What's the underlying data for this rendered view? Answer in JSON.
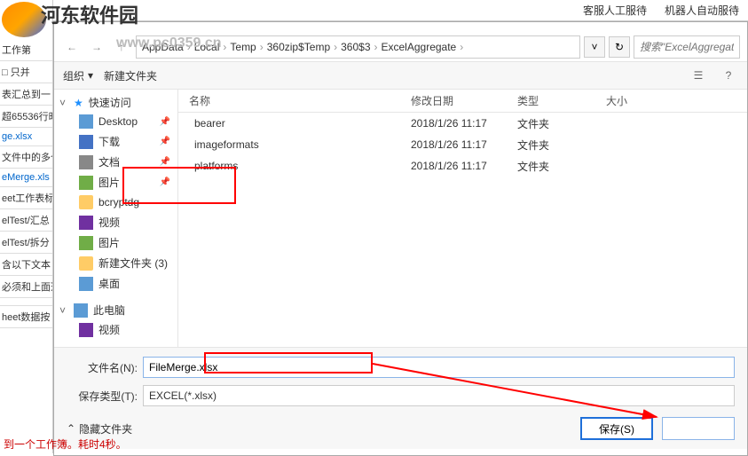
{
  "header_strip": {
    "item1": "客服人工服待",
    "item2": "机器人自动服待"
  },
  "site_title": "河东软件园",
  "watermark": "www.pc0359.cn",
  "left_panel": {
    "items": [
      {
        "text": "工作第",
        "cls": ""
      },
      {
        "text": "□ 只并",
        "cls": ""
      },
      {
        "text": "表汇总到一",
        "cls": ""
      },
      {
        "text": "超65536行时",
        "cls": ""
      },
      {
        "text": "ge.xlsx",
        "cls": "blue"
      },
      {
        "text": "文件中的多个",
        "cls": ""
      },
      {
        "text": "eMerge.xls",
        "cls": "blue"
      },
      {
        "text": "eet工作表标",
        "cls": ""
      },
      {
        "text": "elTest/汇总",
        "cls": ""
      },
      {
        "text": "elTest/拆分",
        "cls": ""
      },
      {
        "text": "含以下文本",
        "cls": ""
      },
      {
        "text": "必须和上面选",
        "cls": ""
      },
      {
        "text": "",
        "cls": ""
      },
      {
        "text": "heet数据按",
        "cls": ""
      }
    ]
  },
  "dialog": {
    "breadcrumb": [
      "AppData",
      "Local",
      "Temp",
      "360zip$Temp",
      "360$3",
      "ExcelAggregate"
    ],
    "search_placeholder": "搜索\"ExcelAggregat",
    "toolbar": {
      "organize": "组织",
      "newfolder": "新建文件夹"
    },
    "sidebar": {
      "quick": "快速访问",
      "items": [
        {
          "label": "Desktop",
          "icon": "ico-desktop",
          "pin": true
        },
        {
          "label": "下载",
          "icon": "ico-dl",
          "pin": true
        },
        {
          "label": "文档",
          "icon": "ico-doc",
          "pin": true
        },
        {
          "label": "图片",
          "icon": "ico-pic",
          "pin": true
        },
        {
          "label": "bcryptdg",
          "icon": "ico-folder",
          "pin": false
        },
        {
          "label": "视频",
          "icon": "ico-vid",
          "pin": false
        },
        {
          "label": "图片",
          "icon": "ico-pic",
          "pin": false
        },
        {
          "label": "新建文件夹 (3)",
          "icon": "ico-folder",
          "pin": false
        },
        {
          "label": "桌面",
          "icon": "ico-desktop",
          "pin": false
        }
      ],
      "thispc": "此电脑",
      "thispc_items": [
        {
          "label": "视频",
          "icon": "ico-vid"
        }
      ]
    },
    "columns": {
      "name": "名称",
      "date": "修改日期",
      "type": "类型",
      "size": "大小"
    },
    "files": [
      {
        "name": "bearer",
        "date": "2018/1/26 11:17",
        "type": "文件夹"
      },
      {
        "name": "imageformats",
        "date": "2018/1/26 11:17",
        "type": "文件夹"
      },
      {
        "name": "platforms",
        "date": "2018/1/26 11:17",
        "type": "文件夹"
      }
    ],
    "filename_label": "文件名(N):",
    "filename_value": "FileMerge.xlsx",
    "filetype_label": "保存类型(T):",
    "filetype_value": "EXCEL(*.xlsx)",
    "hide_folders": "隐藏文件夹",
    "save_btn": "保存(S)",
    "cancel_btn": ""
  },
  "status": "到一个工作簿。耗时4秒。"
}
